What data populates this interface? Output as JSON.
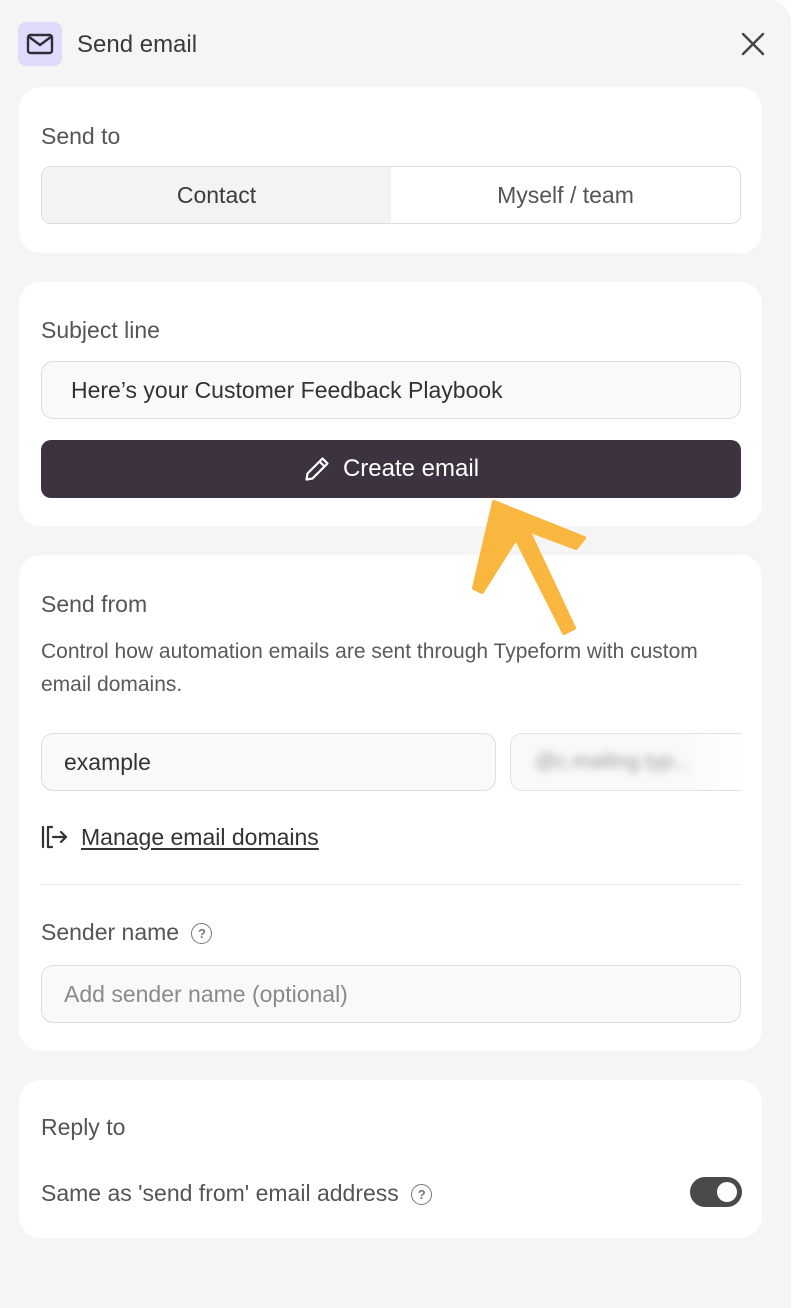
{
  "header": {
    "title": "Send email",
    "icon": "mail-icon",
    "close_icon": "close-icon"
  },
  "send_to": {
    "label": "Send to",
    "options": [
      "Contact",
      "Myself / team"
    ],
    "selected": "Contact"
  },
  "subject": {
    "label": "Subject line",
    "value": "Here’s your Customer Feedback Playbook",
    "create_button_label": "Create email",
    "create_button_icon": "pencil-icon"
  },
  "send_from": {
    "label": "Send from",
    "description": "Control how automation emails are sent through Typeform with custom email domains.",
    "local_part_value": "example",
    "domain_value": "@c.mailing.typ...",
    "manage_link_label": "Manage email domains",
    "manage_link_icon": "external-exit-icon"
  },
  "sender_name": {
    "label": "Sender name",
    "placeholder": "Add sender name (optional)",
    "help_icon": "help-circle-icon"
  },
  "reply_to": {
    "label": "Reply to",
    "option_label": "Same as 'send from' email address",
    "toggle_on": true
  },
  "colors": {
    "primary_button": "#3d3340",
    "header_icon_bg": "#e1dbfb",
    "annotation_arrow": "#f9b73f"
  }
}
